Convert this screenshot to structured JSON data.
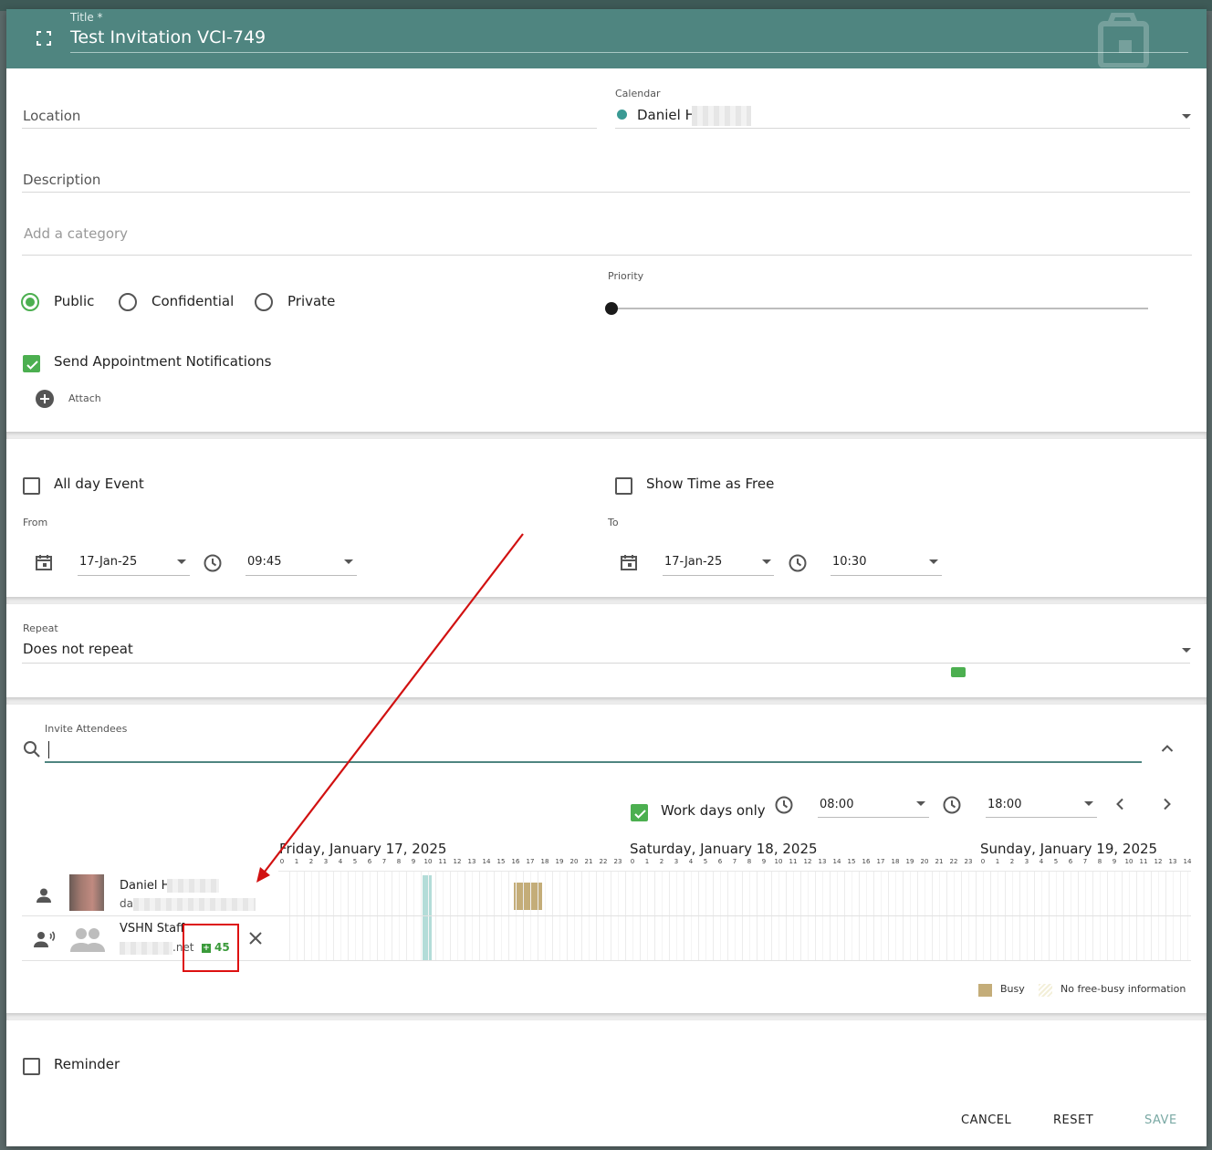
{
  "header": {
    "title_label": "Title *",
    "title_value": "Test Invitation VCI-749"
  },
  "location": {
    "placeholder": "Location"
  },
  "calendar": {
    "label": "Calendar",
    "value": "Daniel H",
    "color": "#3a9a94"
  },
  "description": {
    "placeholder": "Description"
  },
  "category": {
    "placeholder": "Add a category"
  },
  "privacy": {
    "options": [
      "Public",
      "Confidential",
      "Private"
    ],
    "selected": "Public"
  },
  "priority": {
    "label": "Priority",
    "value": 0
  },
  "notifications": {
    "label": "Send Appointment Notifications",
    "checked": true
  },
  "attach": {
    "label": "Attach"
  },
  "all_day": {
    "label": "All day Event",
    "checked": false
  },
  "show_free": {
    "label": "Show Time as Free",
    "checked": false
  },
  "from": {
    "label": "From",
    "date": "17-Jan-25",
    "time": "09:45"
  },
  "to": {
    "label": "To",
    "date": "17-Jan-25",
    "time": "10:30"
  },
  "repeat": {
    "label": "Repeat",
    "value": "Does not repeat"
  },
  "attendees": {
    "label": "Invite Attendees",
    "work_days_only": {
      "label": "Work days only",
      "checked": true
    },
    "start_time": "08:00",
    "end_time": "18:00",
    "days": [
      "Friday, January 17, 2025",
      "Saturday, January 18, 2025",
      "Sunday, January 19, 2025"
    ],
    "hours": [
      "0",
      "1",
      "2",
      "3",
      "4",
      "5",
      "6",
      "7",
      "8",
      "9",
      "10",
      "11",
      "12",
      "13",
      "14",
      "15",
      "16",
      "17",
      "18",
      "19",
      "20",
      "21",
      "22",
      "23"
    ],
    "people": [
      {
        "name": "Daniel H",
        "email": "da"
      },
      {
        "name": "VSHN Staff",
        "email": ".net",
        "badge": "45"
      }
    ],
    "legend": {
      "busy": "Busy",
      "no_info": "No free-busy information"
    }
  },
  "reminder": {
    "label": "Reminder",
    "checked": false
  },
  "actions": {
    "cancel": "CANCEL",
    "reset": "RESET",
    "save": "SAVE"
  },
  "colors": {
    "header": "#4f8580",
    "accent": "#4caf50",
    "busy": "#c4ad79",
    "annotation": "#d11111"
  }
}
